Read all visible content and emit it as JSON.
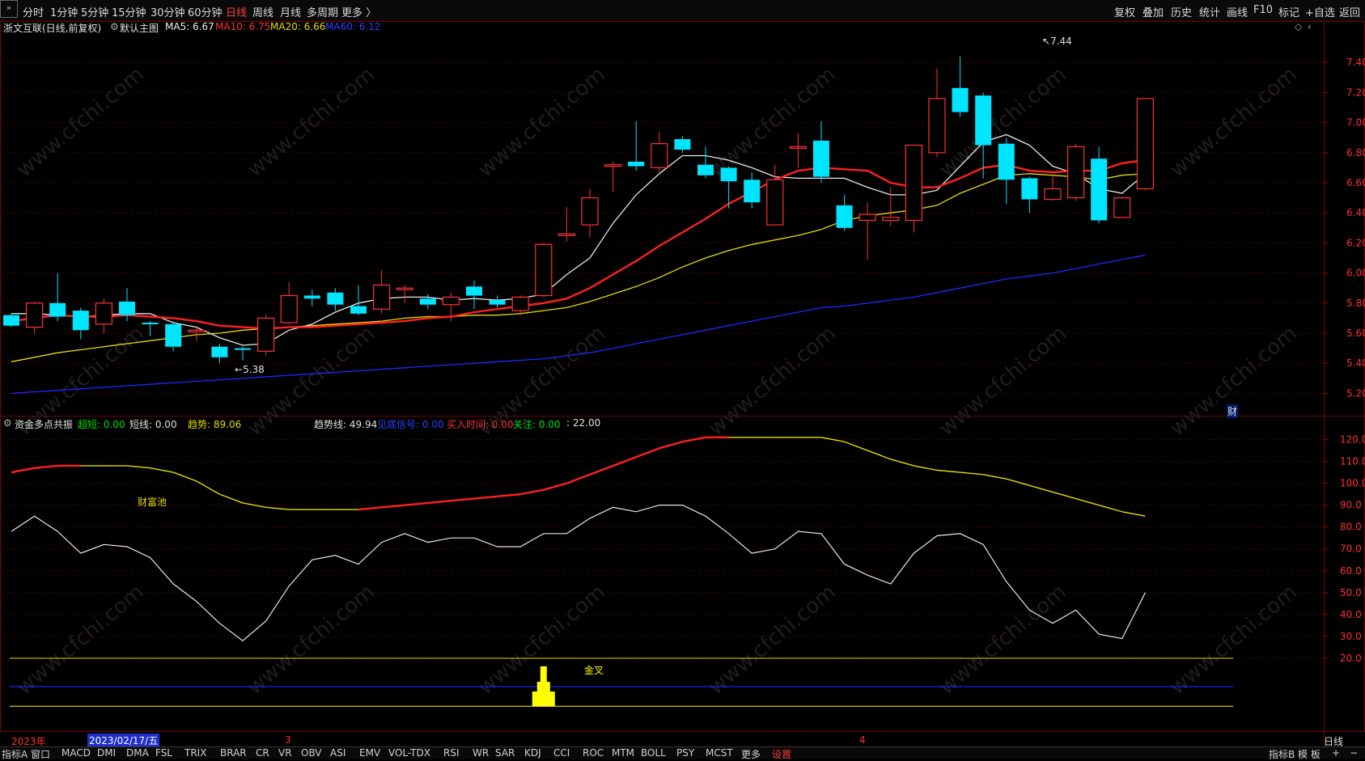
{
  "toolbar": {
    "periods": [
      "分时",
      "1分钟",
      "5分钟",
      "15分钟",
      "30分钟",
      "60分钟",
      "日线",
      "周线",
      "月线",
      "多周期",
      "更多 〉"
    ],
    "active_period": "日线",
    "right_items": [
      "复权",
      "叠加",
      "历史",
      "统计",
      "画线",
      "F10",
      "标记",
      "+自选",
      "返回"
    ]
  },
  "main_header": {
    "title": "浙文互联(日线,前复权)",
    "sub": "默认主图",
    "ma5": "MA5: 6.67",
    "ma10": "MA10: 6.75",
    "ma20": "MA20: 6.66",
    "ma60": "MA60: 6.12"
  },
  "ind_header": {
    "name": "资金多点共振",
    "chaoduan": "超短: 0.00",
    "duanxian": "短线: 0.00",
    "qushi": "趋势: 89.06",
    "qushixian": "趋势线: 49.94",
    "signal": "见底信号: 0.00",
    "buy_time": "买入时间: 0.00",
    "focus": "关注: 0.00",
    "extra": ": 22.00"
  },
  "labels": {
    "high": "7.44",
    "low": "5.38",
    "caifuchi": "财富池",
    "jincha": "金叉",
    "cai": "财",
    "right_period": "日线"
  },
  "date_axis": {
    "year": "2023年",
    "cursor_date": "2023/02/17/五",
    "month3": "3",
    "month4": "4"
  },
  "bottom_tabs": [
    "指标A",
    "窗口",
    "MACD",
    "DMI",
    "DMA",
    "FSL",
    "TRIX",
    "BRAR",
    "CR",
    "VR",
    "OBV",
    "ASI",
    "EMV",
    "VOL-TDX",
    "RSI",
    "WR",
    "SAR",
    "KDJ",
    "CCI",
    "ROC",
    "MTM",
    "BOLL",
    "PSY",
    "MCST",
    "更多",
    "设置"
  ],
  "bottom_right": [
    "指标B",
    "模 板",
    "+",
    "−"
  ],
  "watermark": "www.cfchi.com",
  "colors": {
    "up": "#ff3232",
    "down": "#00e5ff",
    "ma5": "#e8e8e8",
    "ma10": "#ff2020",
    "ma20": "#e6dc00",
    "ma60": "#1a2bff",
    "grid": "#5a0000"
  },
  "chart_data": [
    {
      "type": "candlestick",
      "title": "浙文互联(日线,前复权)",
      "ylim": [
        5.1,
        7.6
      ],
      "y_ticks": [
        "7.40",
        "7.20",
        "7.00",
        "6.80",
        "6.60",
        "6.40",
        "6.20",
        "6.00",
        "5.80",
        "5.60",
        "5.40",
        "5.20"
      ],
      "candles": [
        [
          5.72,
          5.73,
          5.64,
          5.65
        ],
        [
          5.64,
          5.81,
          5.6,
          5.8
        ],
        [
          5.8,
          6.0,
          5.68,
          5.71
        ],
        [
          5.75,
          5.77,
          5.56,
          5.62
        ],
        [
          5.66,
          5.83,
          5.6,
          5.8
        ],
        [
          5.81,
          5.9,
          5.68,
          5.72
        ],
        [
          5.67,
          5.68,
          5.58,
          5.66
        ],
        [
          5.66,
          5.68,
          5.48,
          5.51
        ],
        [
          5.62,
          5.65,
          5.55,
          5.62
        ],
        [
          5.51,
          5.53,
          5.4,
          5.44
        ],
        [
          5.5,
          5.51,
          5.42,
          5.49
        ],
        [
          5.48,
          5.72,
          5.45,
          5.7
        ],
        [
          5.67,
          5.94,
          5.66,
          5.85
        ],
        [
          5.85,
          5.89,
          5.78,
          5.83
        ],
        [
          5.87,
          5.9,
          5.75,
          5.79
        ],
        [
          5.78,
          5.92,
          5.72,
          5.73
        ],
        [
          5.76,
          6.02,
          5.73,
          5.92
        ],
        [
          5.9,
          5.92,
          5.8,
          5.9
        ],
        [
          5.83,
          5.86,
          5.76,
          5.79
        ],
        [
          5.79,
          5.87,
          5.68,
          5.84
        ],
        [
          5.91,
          5.95,
          5.76,
          5.85
        ],
        [
          5.82,
          5.85,
          5.77,
          5.79
        ],
        [
          5.75,
          5.85,
          5.72,
          5.84
        ],
        [
          5.85,
          6.2,
          5.84,
          6.19
        ],
        [
          6.26,
          6.44,
          6.21,
          6.26
        ],
        [
          6.32,
          6.56,
          6.24,
          6.5
        ],
        [
          6.72,
          6.74,
          6.54,
          6.72
        ],
        [
          6.74,
          7.01,
          6.68,
          6.71
        ],
        [
          6.7,
          6.94,
          6.67,
          6.86
        ],
        [
          6.89,
          6.91,
          6.8,
          6.82
        ],
        [
          6.72,
          6.84,
          6.63,
          6.65
        ],
        [
          6.7,
          6.71,
          6.43,
          6.61
        ],
        [
          6.62,
          6.67,
          6.43,
          6.47
        ],
        [
          6.32,
          6.72,
          6.32,
          6.62
        ],
        [
          6.84,
          6.93,
          6.7,
          6.84
        ],
        [
          6.88,
          7.01,
          6.6,
          6.64
        ],
        [
          6.45,
          6.52,
          6.28,
          6.3
        ],
        [
          6.35,
          6.47,
          6.09,
          6.39
        ],
        [
          6.35,
          6.57,
          6.31,
          6.37
        ],
        [
          6.35,
          6.84,
          6.27,
          6.85
        ],
        [
          6.8,
          7.36,
          6.77,
          7.16
        ],
        [
          7.23,
          7.44,
          7.04,
          7.07
        ],
        [
          7.18,
          7.2,
          6.63,
          6.85
        ],
        [
          6.86,
          6.9,
          6.46,
          6.62
        ],
        [
          6.63,
          6.64,
          6.4,
          6.49
        ],
        [
          6.49,
          6.64,
          6.48,
          6.56
        ],
        [
          6.5,
          6.86,
          6.48,
          6.84
        ],
        [
          6.76,
          6.84,
          6.33,
          6.35
        ],
        [
          6.37,
          6.51,
          6.37,
          6.5
        ],
        [
          6.56,
          7.16,
          6.55,
          7.16
        ]
      ],
      "series": [
        {
          "name": "MA5",
          "values": [
            5.73,
            5.73,
            5.72,
            5.71,
            5.72,
            5.73,
            5.73,
            5.67,
            5.64,
            5.57,
            5.52,
            5.53,
            5.62,
            5.66,
            5.74,
            5.8,
            5.83,
            5.84,
            5.84,
            5.82,
            5.83,
            5.82,
            5.83,
            5.86,
            5.99,
            6.1,
            6.33,
            6.52,
            6.66,
            6.78,
            6.78,
            6.75,
            6.7,
            6.64,
            6.63,
            6.63,
            6.63,
            6.57,
            6.52,
            6.52,
            6.55,
            6.71,
            6.87,
            6.92,
            6.85,
            6.71,
            6.66,
            6.56,
            6.53,
            6.66
          ]
        },
        {
          "name": "MA10",
          "values": [
            5.68,
            5.7,
            5.72,
            5.71,
            5.71,
            5.72,
            5.71,
            5.7,
            5.68,
            5.65,
            5.64,
            5.63,
            5.64,
            5.64,
            5.65,
            5.66,
            5.67,
            5.68,
            5.7,
            5.71,
            5.74,
            5.76,
            5.78,
            5.8,
            5.83,
            5.9,
            5.99,
            6.08,
            6.18,
            6.27,
            6.36,
            6.46,
            6.54,
            6.62,
            6.68,
            6.7,
            6.69,
            6.68,
            6.6,
            6.57,
            6.57,
            6.63,
            6.7,
            6.72,
            6.68,
            6.67,
            6.68,
            6.68,
            6.73,
            6.75
          ]
        },
        {
          "name": "MA20",
          "values": [
            5.41,
            5.44,
            5.47,
            5.49,
            5.51,
            5.53,
            5.55,
            5.57,
            5.59,
            5.6,
            5.62,
            5.63,
            5.64,
            5.65,
            5.66,
            5.67,
            5.68,
            5.7,
            5.71,
            5.71,
            5.72,
            5.72,
            5.73,
            5.75,
            5.77,
            5.81,
            5.86,
            5.91,
            5.97,
            6.04,
            6.1,
            6.15,
            6.19,
            6.22,
            6.25,
            6.29,
            6.35,
            6.38,
            6.4,
            6.42,
            6.45,
            6.53,
            6.59,
            6.65,
            6.66,
            6.65,
            6.64,
            6.62,
            6.65,
            6.66
          ]
        },
        {
          "name": "MA60",
          "values": [
            5.2,
            5.21,
            5.22,
            5.23,
            5.24,
            5.25,
            5.26,
            5.27,
            5.28,
            5.29,
            5.3,
            5.31,
            5.32,
            5.33,
            5.34,
            5.35,
            5.36,
            5.37,
            5.38,
            5.39,
            5.4,
            5.41,
            5.42,
            5.43,
            5.45,
            5.47,
            5.5,
            5.53,
            5.56,
            5.59,
            5.62,
            5.65,
            5.68,
            5.71,
            5.74,
            5.77,
            5.78,
            5.8,
            5.82,
            5.84,
            5.87,
            5.9,
            5.93,
            5.96,
            5.98,
            6.0,
            6.03,
            6.06,
            6.09,
            6.12
          ]
        }
      ]
    },
    {
      "type": "line",
      "title": "资金多点共振",
      "ylim": [
        0,
        125
      ],
      "y_ticks": [
        "120.0",
        "110.0",
        "100.0",
        "90.0",
        "80.0",
        "70.0",
        "60.0",
        "50.0",
        "40.0",
        "30.0",
        "20.0"
      ],
      "series": [
        {
          "name": "趋势",
          "values": [
            105,
            107,
            108,
            108,
            108,
            108,
            107,
            105,
            101,
            95,
            91,
            89,
            88,
            88,
            88,
            88,
            89,
            90,
            91,
            92,
            93,
            94,
            95,
            97,
            100,
            104,
            108,
            112,
            116,
            119,
            121,
            121,
            121,
            121,
            121,
            121,
            119,
            115,
            111,
            108,
            106,
            105,
            104,
            102,
            99,
            96,
            93,
            90,
            87,
            85
          ]
        },
        {
          "name": "趋势线",
          "values": [
            78,
            85,
            78,
            68,
            72,
            71,
            66,
            54,
            46,
            36,
            28,
            37,
            53,
            65,
            67,
            63,
            73,
            77,
            73,
            75,
            75,
            71,
            71,
            77,
            77,
            84,
            89,
            87,
            90,
            90,
            85,
            77,
            68,
            70,
            78,
            77,
            63,
            58,
            54,
            68,
            76,
            77,
            72,
            55,
            42,
            36,
            42,
            31,
            29,
            50
          ]
        }
      ],
      "levels": [
        20,
        7,
        -2
      ]
    }
  ]
}
